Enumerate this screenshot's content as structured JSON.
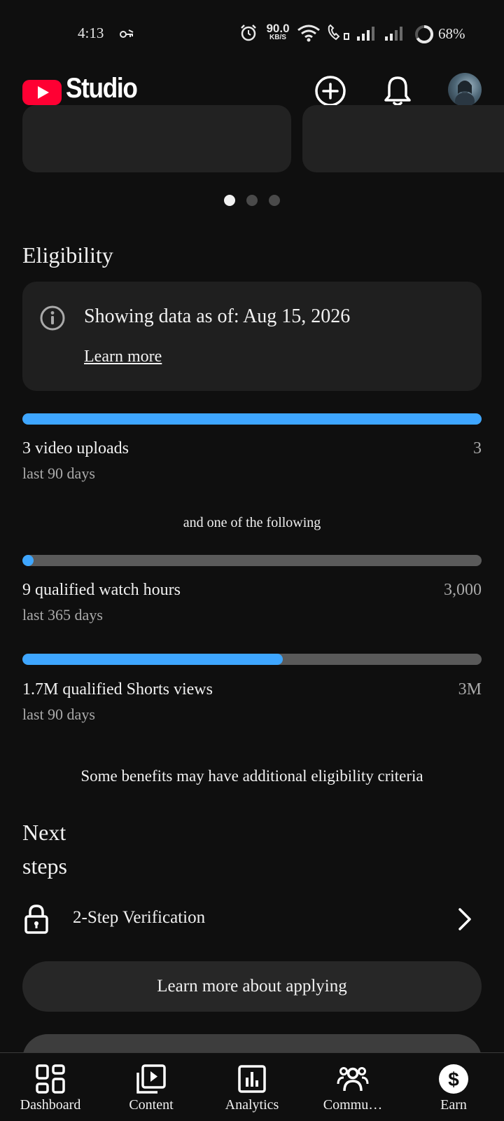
{
  "status_bar": {
    "time": "4:13",
    "net_speed_value": "90.0",
    "net_speed_unit": "KB/S",
    "battery": "68%"
  },
  "header": {
    "app_name": "Studio",
    "create_icon": "add-circle-icon",
    "notifications_icon": "bell-icon"
  },
  "carousel": {
    "page_count": 3,
    "active_index": 0
  },
  "eligibility": {
    "title": "Eligibility",
    "info": {
      "text": "Showing data as of: Aug 15, 2026",
      "link": "Learn more"
    },
    "requirements": [
      {
        "label": "3 video uploads",
        "period": "last 90 days",
        "target": "3",
        "progress": 1.0
      },
      {
        "label": "9 qualified watch hours",
        "period": "last 365 days",
        "target": "3,000",
        "progress": 0.003
      },
      {
        "label": "1.7M qualified Shorts views",
        "period": "last 90 days",
        "target": "3M",
        "progress": 0.5667
      }
    ],
    "divider_text": "and one of the following",
    "footnote": "Some benefits may have additional eligibility criteria"
  },
  "next_steps": {
    "title_line1": "Next",
    "title_line2": "steps",
    "items": [
      {
        "label": "2-Step Verification",
        "icon": "lock-icon"
      }
    ],
    "apply_button": "Learn more about applying"
  },
  "bottom_nav": [
    {
      "label": "Dashboard",
      "icon": "dashboard-icon"
    },
    {
      "label": "Content",
      "icon": "content-icon"
    },
    {
      "label": "Analytics",
      "icon": "analytics-icon"
    },
    {
      "label": "Commu…",
      "icon": "community-icon"
    },
    {
      "label": "Earn",
      "icon": "earn-icon",
      "active": true
    }
  ],
  "colors": {
    "background": "#0f0f0f",
    "card": "#1f1f1f",
    "progress_fill": "#3ea6ff",
    "progress_track": "#5a5a5a",
    "brand_red": "#ff0033"
  }
}
